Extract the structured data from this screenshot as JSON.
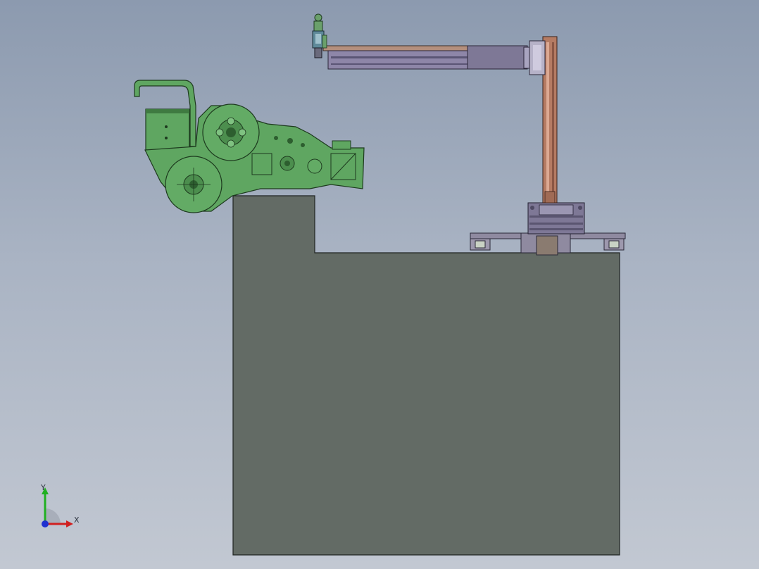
{
  "viewport": {
    "background_top": "#8c9aaf",
    "background_bottom": "#c2c8d2"
  },
  "model": {
    "parts": [
      {
        "name": "machine-base",
        "color": "#636b65"
      },
      {
        "name": "feeder-unit",
        "color": "#5fa661"
      },
      {
        "name": "linear-rail",
        "color": "#8f8aa0"
      },
      {
        "name": "slewing-base",
        "color": "#7e7896"
      },
      {
        "name": "vertical-column",
        "color": "#b57b63"
      },
      {
        "name": "horizontal-arm",
        "color": "#8e86a8"
      },
      {
        "name": "end-effector",
        "color": "#6aa06b"
      }
    ]
  },
  "triad": {
    "x_label": "X",
    "y_label": "Y",
    "x_color": "#d02020",
    "y_color": "#20b020",
    "z_color": "#2030d0"
  }
}
